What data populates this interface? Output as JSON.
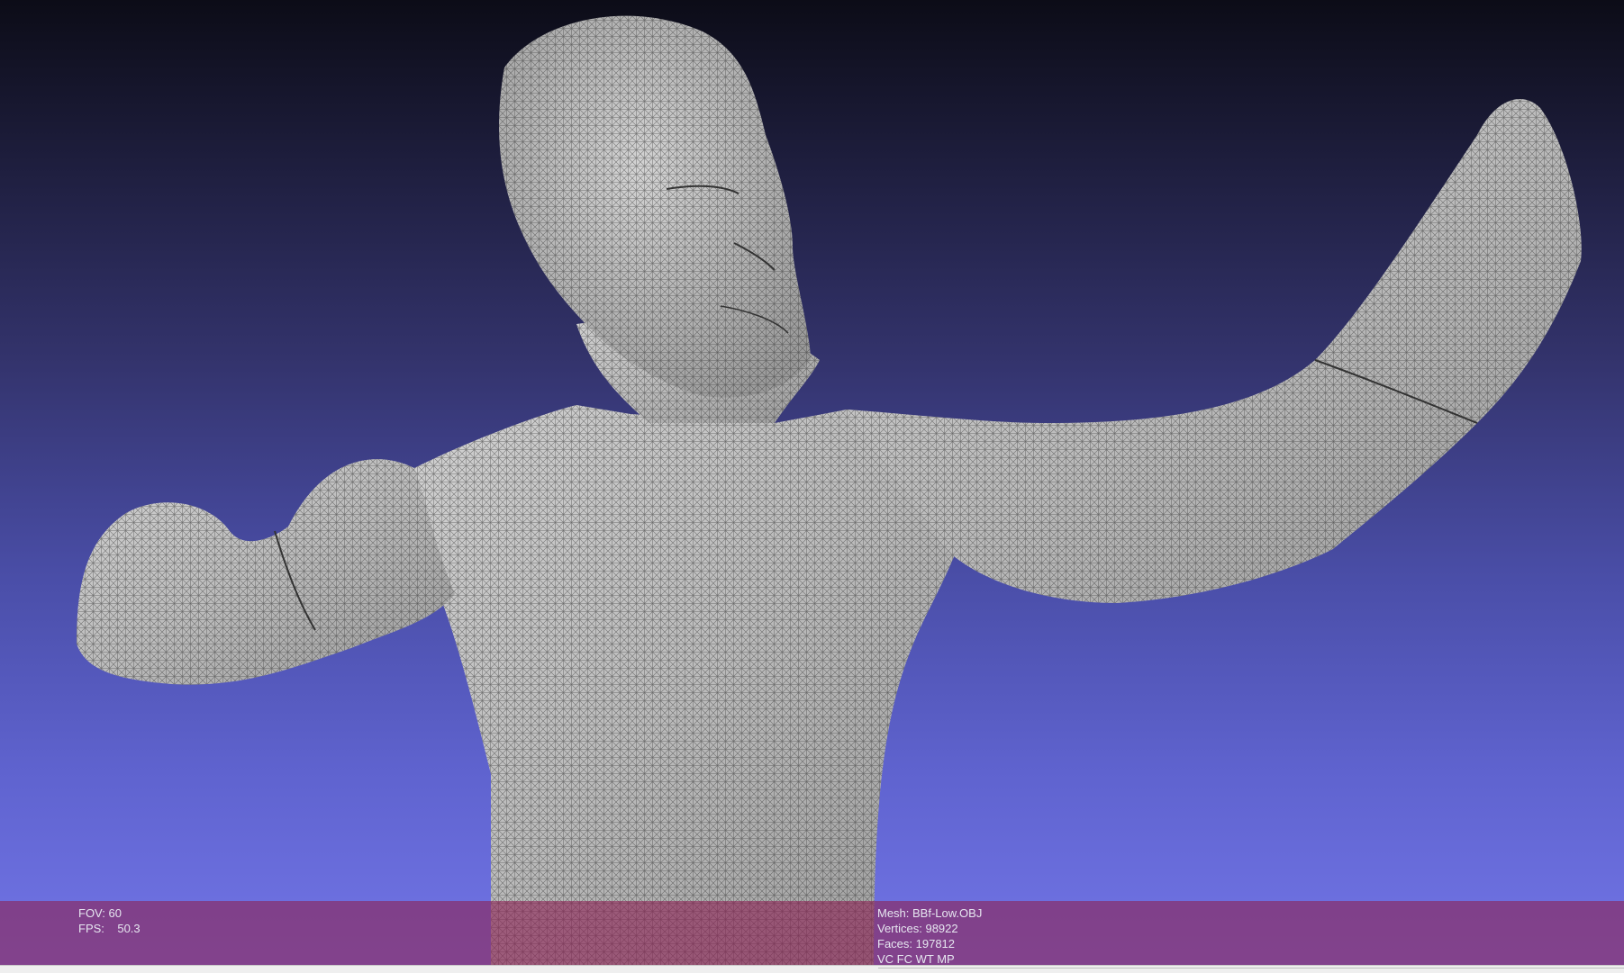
{
  "viewer": {
    "background_top": "#0c0c17",
    "background_bottom": "#7275e6",
    "mesh_color": "#b9b9b9",
    "wire_color": "#2a2a2a",
    "overlay_color": "#8c2355"
  },
  "info": {
    "fov": "FOV: 60",
    "fps": "FPS:    50.3",
    "mesh": "Mesh: BBf-Low.OBJ",
    "vertices": "Vertices: 98922",
    "faces": "Faces: 197812",
    "flags": "VC FC WT MP"
  }
}
